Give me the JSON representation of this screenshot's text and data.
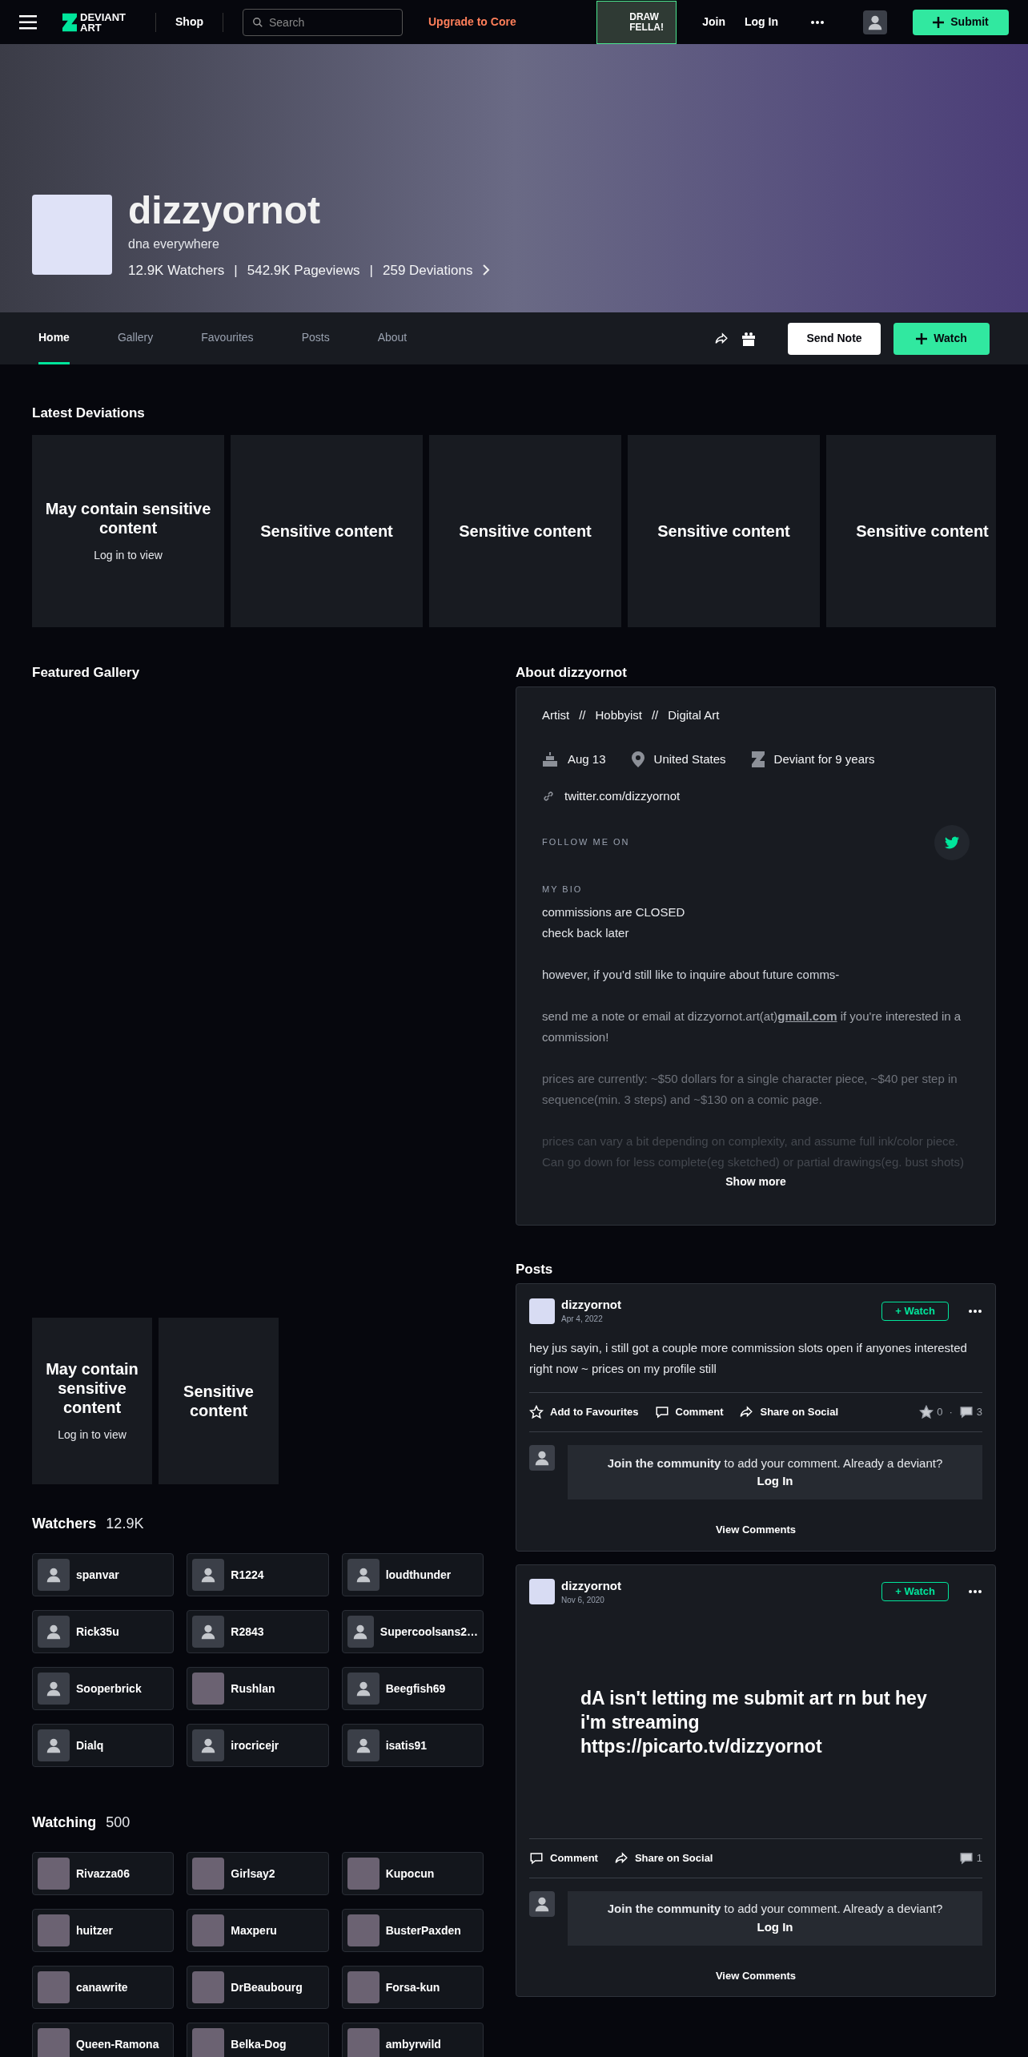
{
  "topbar": {
    "logo": "DEVIANT ART",
    "shop": "Shop",
    "search_placeholder": "Search",
    "upgrade": "Upgrade to Core",
    "promo": "DRAW FELLA!",
    "join": "Join",
    "login": "Log In",
    "submit": "Submit"
  },
  "profile": {
    "name": "dizzyornot",
    "tagline": "dna everywhere",
    "stats": [
      "12.9K Watchers",
      "542.9K Pageviews",
      "259 Deviations"
    ],
    "stat_separator": "|"
  },
  "tabs": [
    {
      "label": "Home",
      "selected": true
    },
    {
      "label": "Gallery",
      "selected": false
    },
    {
      "label": "Favourites",
      "selected": false
    },
    {
      "label": "Posts",
      "selected": false
    },
    {
      "label": "About",
      "selected": false
    }
  ],
  "actions": {
    "send_note": "Send Note",
    "watch": "Watch"
  },
  "latest": {
    "title": "Latest Deviations",
    "tiles": [
      {
        "title": "May contain sensitive content",
        "sub": "Log in to view"
      },
      {
        "title": "Sensitive content"
      },
      {
        "title": "Sensitive content"
      },
      {
        "title": "Sensitive content"
      },
      {
        "title": "Sensitive content"
      }
    ]
  },
  "featured": {
    "title": "Featured Gallery",
    "tiles": [
      {
        "title": "May contain sensitive content",
        "sub": "Log in to view"
      },
      {
        "title": "Sensitive content"
      }
    ]
  },
  "watchers": {
    "title": "Watchers",
    "count": "12.9K",
    "users": [
      {
        "name": "spanvar",
        "kind": "default"
      },
      {
        "name": "R1224",
        "kind": "default"
      },
      {
        "name": "loudthunder",
        "kind": "default"
      },
      {
        "name": "Rick35u",
        "kind": "default"
      },
      {
        "name": "R2843",
        "kind": "default"
      },
      {
        "name": "Supercoolsans2…",
        "kind": "default"
      },
      {
        "name": "Sooperbrick",
        "kind": "default"
      },
      {
        "name": "Rushlan",
        "kind": "photo"
      },
      {
        "name": "Beegfish69",
        "kind": "default"
      },
      {
        "name": "Dialq",
        "kind": "default"
      },
      {
        "name": "irocricejr",
        "kind": "default"
      },
      {
        "name": "isatis91",
        "kind": "default"
      }
    ]
  },
  "watching": {
    "title": "Watching",
    "count": "500",
    "users": [
      {
        "name": "Rivazza06",
        "kind": "photo"
      },
      {
        "name": "Girlsay2",
        "kind": "photo"
      },
      {
        "name": "Kupocun",
        "kind": "photo"
      },
      {
        "name": "huitzer",
        "kind": "photo"
      },
      {
        "name": "Maxperu",
        "kind": "photo"
      },
      {
        "name": "BusterPaxden",
        "kind": "photo"
      },
      {
        "name": "canawrite",
        "kind": "photo"
      },
      {
        "name": "DrBeaubourg",
        "kind": "photo"
      },
      {
        "name": "Forsa-kun",
        "kind": "photo"
      },
      {
        "name": "Queen-Ramona",
        "kind": "photo"
      },
      {
        "name": "Belka-Dog",
        "kind": "photo"
      },
      {
        "name": "ambyrwild",
        "kind": "photo"
      }
    ]
  },
  "about": {
    "title": "About dizzyornot",
    "roles": [
      "Artist",
      "Hobbyist",
      "Digital Art"
    ],
    "role_separator": "//",
    "facts": [
      {
        "kind": "birthday",
        "text": "Aug 13"
      },
      {
        "kind": "location",
        "text": "United States"
      },
      {
        "kind": "member",
        "text": "Deviant for 9 years"
      }
    ],
    "link": "twitter.com/dizzyornot",
    "follow_label": "FOLLOW ME ON",
    "bio_label": "MY BIO",
    "bio": [
      {
        "text": "commissions are CLOSED\ncheck back later"
      },
      {
        "text": "however, if you'd still like to inquire about future comms-"
      },
      {
        "text": "send me a note or email at dizzyornot.art(at)",
        "link": "gmail.com",
        "after": " if you're interested in a commission!"
      },
      {
        "text": "prices are currently: ~$50 dollars for a single character piece, ~$40 per step in sequence(min. 3 steps) and ~$130 on a comic page."
      },
      {
        "text": "prices can vary a bit depending on complexity, and assume full ink/color piece. Can go down for less complete(eg sketched) or partial drawings(eg. bust shots)"
      }
    ],
    "show_more": "Show more"
  },
  "posts": {
    "title": "Posts",
    "items": [
      {
        "author": "dizzyornot",
        "date": "Apr 4, 2022",
        "watch": "+ Watch",
        "kind": "text",
        "stat_separator": "·",
        "body": "hey jus sayin, i still got a couple more commission slots open if anyones interested right now ~ prices on my profile still",
        "actions": [
          {
            "kind": "favourite",
            "label": "Add to Favourites"
          },
          {
            "kind": "comment",
            "label": "Comment"
          },
          {
            "kind": "share",
            "label": "Share on Social"
          }
        ],
        "stats": [
          {
            "kind": "favourite",
            "value": "0"
          },
          {
            "kind": "comment",
            "value": "3"
          }
        ],
        "join": "**Join the community** to add your comment. Already a deviant?",
        "login": "Log In",
        "view_comments": "View Comments"
      },
      {
        "author": "dizzyornot",
        "date": "Nov 6, 2020",
        "watch": "+ Watch",
        "kind": "big_text",
        "body": "dA isn't letting me submit art rn but hey i'm streaming https://picarto.tv/dizzyornot",
        "actions": [
          {
            "kind": "comment",
            "label": "Comment"
          },
          {
            "kind": "share",
            "label": "Share on Social"
          }
        ],
        "stats": [
          {
            "kind": "comment",
            "value": "1"
          }
        ],
        "join": "**Join the community** to add your comment. Already a deviant?",
        "login": "Log In",
        "view_comments": "View Comments"
      }
    ]
  }
}
